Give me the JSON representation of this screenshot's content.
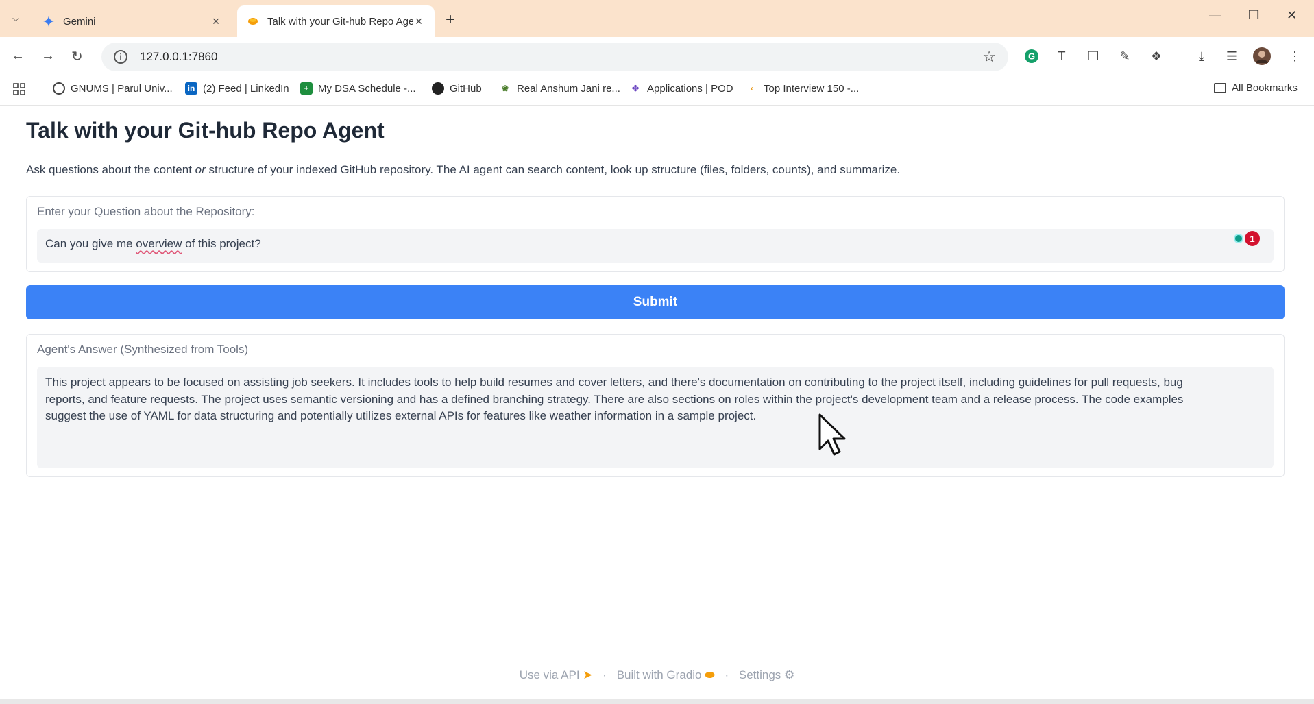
{
  "browser": {
    "tabs": [
      {
        "title": "Gemini",
        "icon": "gemini-star-icon",
        "active": false
      },
      {
        "title": "Talk with your Git-hub Repo Agent",
        "icon": "gradio-icon",
        "active": true
      }
    ],
    "url": "127.0.0.1:7860",
    "bookmarks": [
      {
        "label": "GNUMS | Parul Univ...",
        "icon": "globe-icon"
      },
      {
        "label": "(2) Feed | LinkedIn",
        "icon": "linkedin-icon",
        "icon_text": "in"
      },
      {
        "label": "My DSA Schedule -...",
        "icon": "sheets-icon"
      },
      {
        "label": "GitHub",
        "icon": "github-icon"
      },
      {
        "label": "Real Anshum Jani re...",
        "icon": "leaf-icon"
      },
      {
        "label": "Applications | POD",
        "icon": "pod-icon"
      },
      {
        "label": "Top Interview 150 -...",
        "icon": "leetcode-icon"
      }
    ],
    "all_bookmarks": "All Bookmarks"
  },
  "app": {
    "title": "Talk with your Git-hub Repo Agent",
    "description_pre": "Ask questions about the content ",
    "description_em": "or",
    "description_post": " structure of your indexed GitHub repository. The AI agent can search content, look up structure (files, folders, counts), and summarize.",
    "question": {
      "label": "Enter your Question about the Repository:",
      "value_pre": "Can you give me ",
      "value_flagged": "overview",
      "value_post": " of this project?",
      "grammar_count": "1"
    },
    "submit_label": "Submit",
    "answer": {
      "label": "Agent's Answer (Synthesized from Tools)",
      "line1": "This project appears to be focused on assisting job seekers.  It includes tools to help build resumes and cover letters, and there's documentation on contributing to the project itself, including guidelines for pull requests, bug",
      "line2": "reports, and feature requests.  The project uses semantic versioning and has a defined branching strategy.  There are also sections on roles within the project's development team and a release process.  The code examples",
      "line3": "suggest the use of YAML for data structuring and potentially utilizes external APIs for features like weather information in a sample project."
    }
  },
  "footer": {
    "use_api": "Use via API",
    "built_with": "Built with Gradio",
    "settings": "Settings",
    "separator": "·"
  },
  "colors": {
    "tabstrip": "#fbe3cc",
    "submit": "#3b82f6",
    "grammarly_badge": "#d3122f"
  }
}
